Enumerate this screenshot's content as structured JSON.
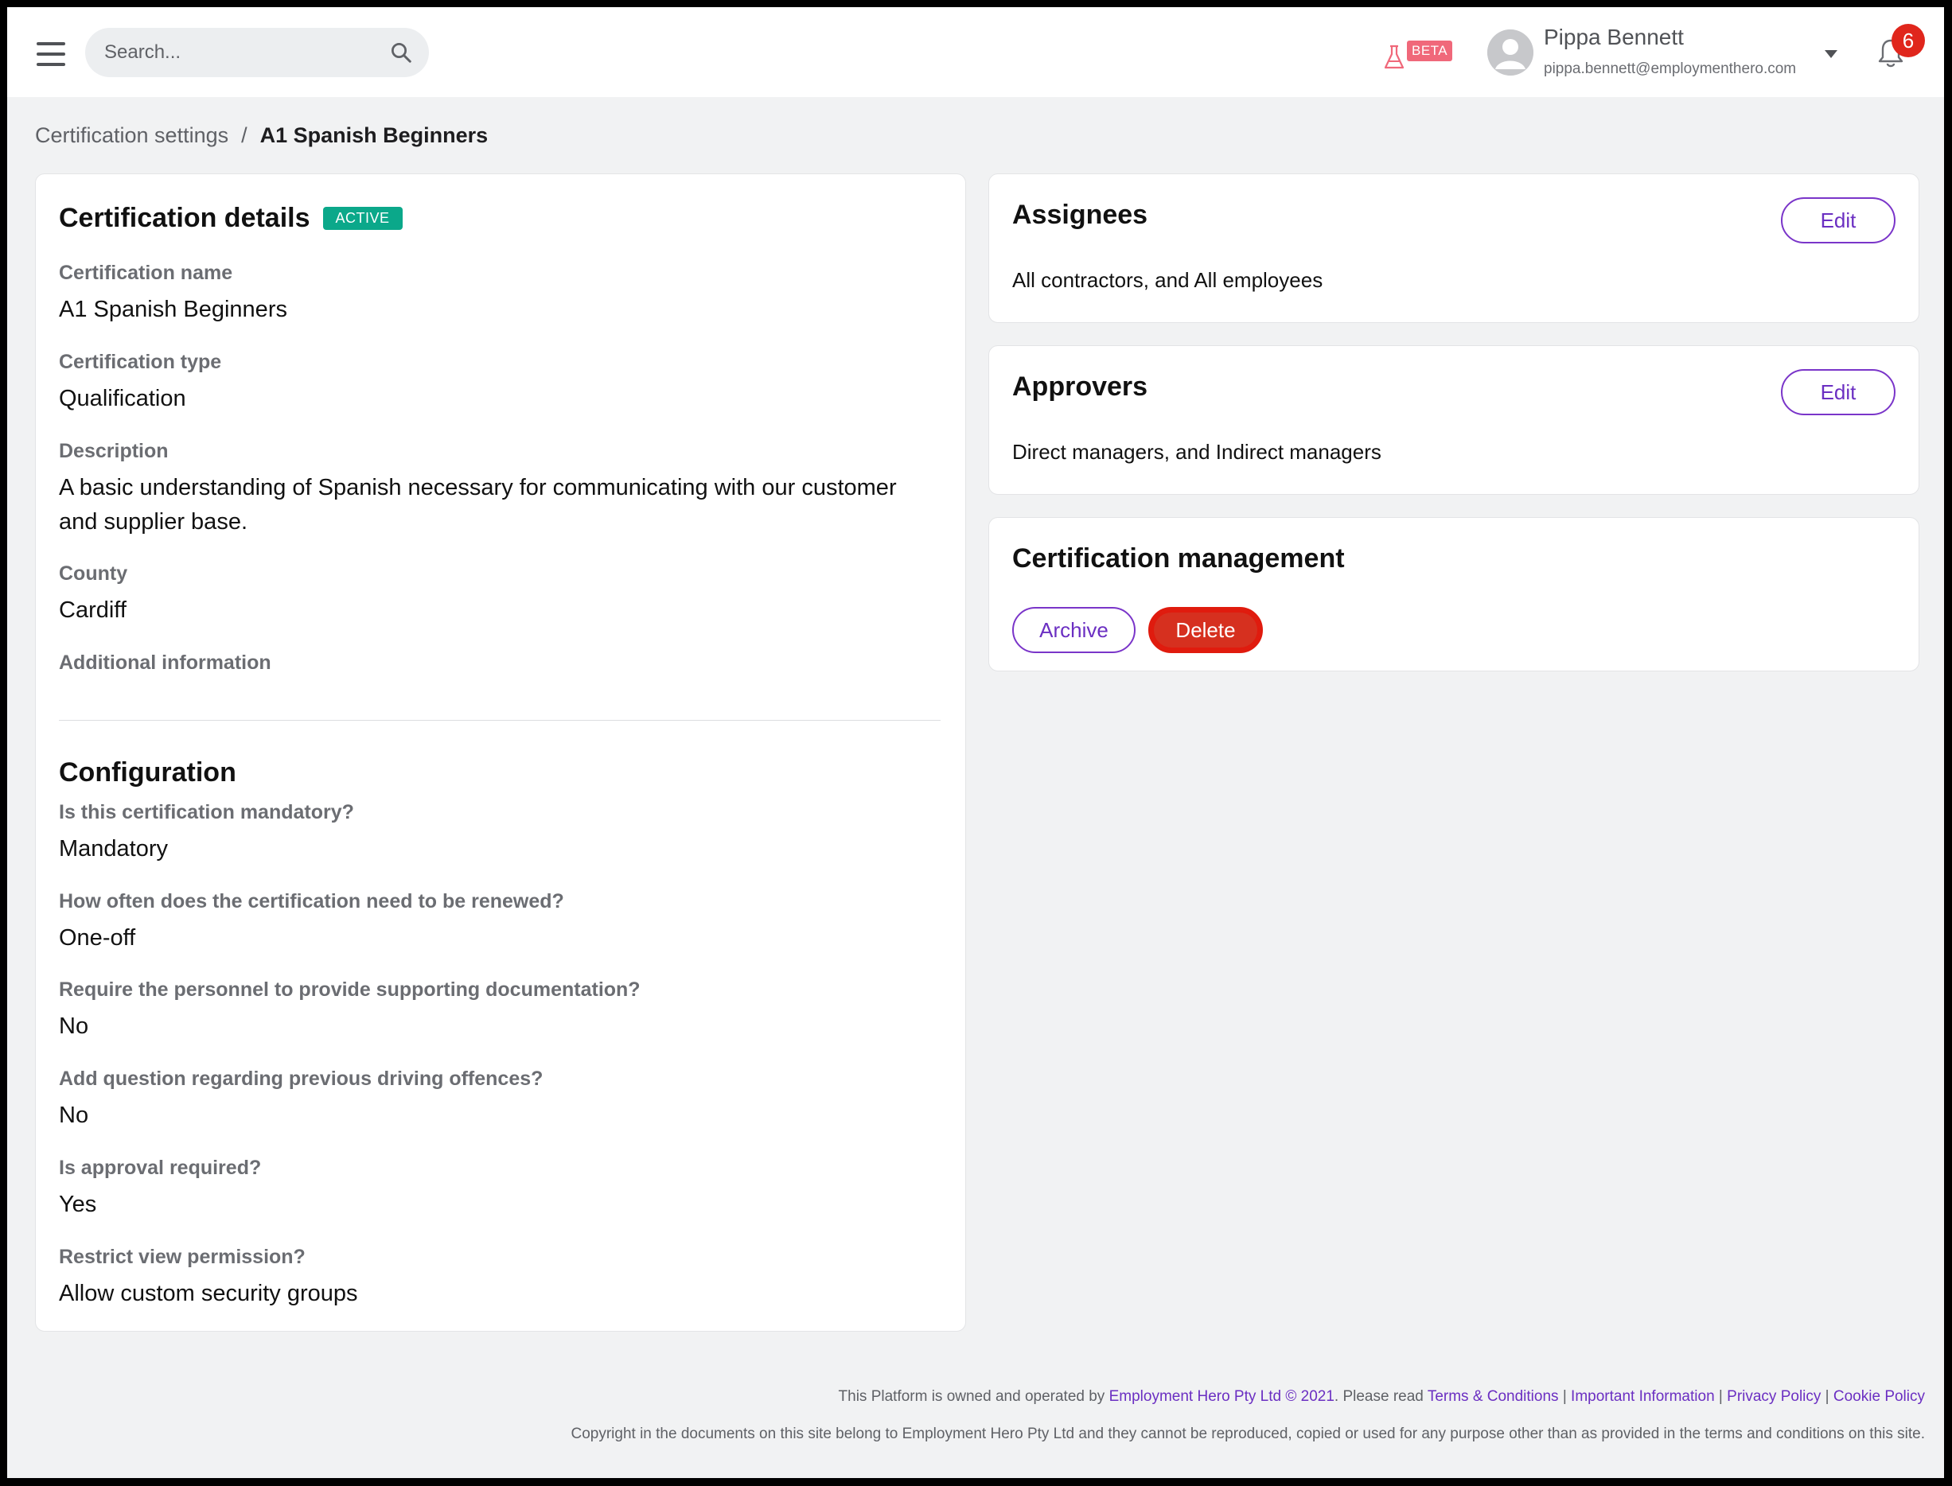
{
  "header": {
    "search_placeholder": "Search...",
    "beta_label": "BETA",
    "user_name": "Pippa Bennett",
    "user_email": "pippa.bennett@employmenthero.com",
    "notification_count": "6"
  },
  "breadcrumb": {
    "parent": "Certification settings",
    "separator": "/",
    "current": "A1 Spanish Beginners"
  },
  "details": {
    "title": "Certification details",
    "status": "ACTIVE",
    "fields": [
      {
        "label": "Certification name",
        "value": "A1 Spanish Beginners"
      },
      {
        "label": "Certification type",
        "value": "Qualification"
      },
      {
        "label": "Description",
        "value": "A basic understanding of Spanish necessary for communicating with our customer and supplier base."
      },
      {
        "label": "County",
        "value": "Cardiff"
      },
      {
        "label": "Additional information",
        "value": ""
      }
    ]
  },
  "configuration": {
    "title": "Configuration",
    "fields": [
      {
        "label": "Is this certification mandatory?",
        "value": "Mandatory"
      },
      {
        "label": "How often does the certification need to be renewed?",
        "value": "One-off"
      },
      {
        "label": "Require the personnel to provide supporting documentation?",
        "value": "No"
      },
      {
        "label": "Add question regarding previous driving offences?",
        "value": "No"
      },
      {
        "label": "Is approval required?",
        "value": "Yes"
      },
      {
        "label": "Restrict view permission?",
        "value": "Allow custom security groups"
      }
    ]
  },
  "assignees": {
    "title": "Assignees",
    "edit_label": "Edit",
    "text": "All contractors, and All employees"
  },
  "approvers": {
    "title": "Approvers",
    "edit_label": "Edit",
    "text": "Direct managers, and Indirect managers"
  },
  "management": {
    "title": "Certification management",
    "archive_label": "Archive",
    "delete_label": "Delete"
  },
  "footer": {
    "prefix": "This Platform is owned and operated by ",
    "company_link": "Employment Hero Pty Ltd © 2021",
    "please_read": ". Please read ",
    "terms": "Terms & Conditions",
    "sep": " | ",
    "important": "Important Information",
    "privacy": "Privacy Policy",
    "cookie": "Cookie Policy",
    "copyright": "Copyright in the documents on this site belong to Employment Hero Pty Ltd and they cannot be reproduced, copied or used for any purpose other than as provided in the terms and conditions on this site."
  },
  "colors": {
    "accent": "#6b2fc2",
    "active_badge": "#0ba88a",
    "danger": "#d6301f",
    "notification": "#e0261c"
  }
}
